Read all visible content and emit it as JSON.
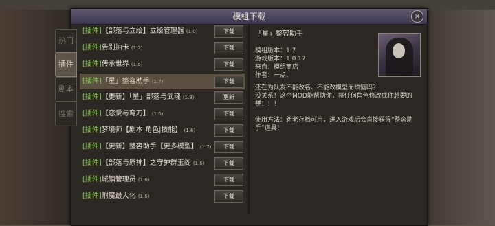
{
  "dialog": {
    "title": "模组下载",
    "close_icon": "×"
  },
  "tabs": [
    {
      "label": "热门",
      "active": false
    },
    {
      "label": "插件",
      "active": true
    },
    {
      "label": "剧本",
      "active": false
    },
    {
      "label": "搜索",
      "active": false
    }
  ],
  "mods": [
    {
      "tag": "[插件]",
      "name": "【部落与立绘】立绘管理器",
      "ver": "(1.0)",
      "button": "下载",
      "selected": false
    },
    {
      "tag": "[插件]",
      "name": "告别抽卡",
      "ver": "(1.2)",
      "button": "下载",
      "selected": false
    },
    {
      "tag": "[插件]",
      "name": "传承世界",
      "ver": "(1.5)",
      "button": "下载",
      "selected": false
    },
    {
      "tag": "[插件]",
      "name": "「星」整容助手",
      "ver": "(1.7)",
      "button": "下载",
      "selected": true
    },
    {
      "tag": "[插件]",
      "name": "【更新】「星」部落与武魂",
      "ver": "(1.9)",
      "button": "更新",
      "selected": false
    },
    {
      "tag": "[插件]",
      "name": "【恋爱与弯刀】",
      "ver": "(1.6)",
      "button": "下载",
      "selected": false
    },
    {
      "tag": "[插件]",
      "name": "梦境师【剧本|角色|技能】",
      "ver": "(1.6)",
      "button": "下载",
      "selected": false
    },
    {
      "tag": "[插件]",
      "name": "【更新】整容助手【更多模型】",
      "ver": "(1.7)",
      "button": "下载",
      "selected": false
    },
    {
      "tag": "[插件]",
      "name": "【部落与原神】之守护群玉阁",
      "ver": "(1.6)",
      "button": "下载",
      "selected": false
    },
    {
      "tag": "[插件]",
      "name": "城镇管理员",
      "ver": "(1.6)",
      "button": "下载",
      "selected": false
    },
    {
      "tag": "[插件]",
      "name": "附魔最大化",
      "ver": "(1.6)",
      "button": "下载",
      "selected": false
    }
  ],
  "detail": {
    "title": "「星」整容助手",
    "mod_version": "模组版本：1.7",
    "game_version": "游戏版本：1.0.17",
    "source": "来自：模组商店",
    "author": "作者：一点、",
    "desc1_line1": "还在为队友不能改名、不能改模型而烦恼吗？",
    "desc1_line2": "没关系！这个MOD能帮助你，将任何角色修改成你想要的样",
    "desc1_line3": "子！！！",
    "desc2_line1": "使用方法：新老存档可用，进入游戏后会直接获得“整容助",
    "desc2_line2": "手”道具！"
  }
}
